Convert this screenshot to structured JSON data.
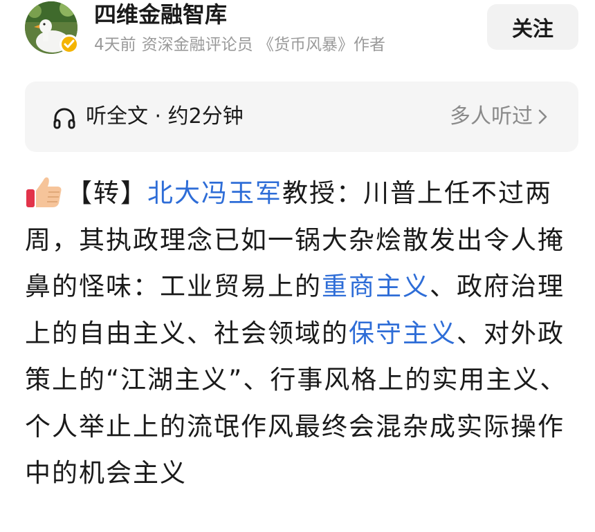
{
  "author": {
    "name": "四维金融智库",
    "time_ago": "4天前",
    "description": "资深金融评论员 《货币风暴》作者",
    "avatar": "duck-avatar",
    "verified_icon": "check-icon"
  },
  "follow": {
    "label": "关注"
  },
  "listen": {
    "icon": "headphone-icon",
    "label": "听全文 · 约2分钟",
    "right_text": "多人听过",
    "right_icon": "chevron-right-icon"
  },
  "article": {
    "emoji": "thumbs-up-icon",
    "segments": [
      {
        "text": "【转】",
        "link": false
      },
      {
        "text": "北大冯玉军",
        "link": true
      },
      {
        "text": "教授：川普上任不过两周，其执政理念已如一锅大杂烩散发出令人掩鼻的怪味：工业贸易上的",
        "link": false
      },
      {
        "text": "重商主义",
        "link": true
      },
      {
        "text": "、政府治理上的自由主义、社会领域的",
        "link": false
      },
      {
        "text": "保守主义",
        "link": true
      },
      {
        "text": "、对外政策上的“江湖主义”、行事风格上的实用主义、个人举止上的流氓作风最终会混杂成实际操作中的机会主义",
        "link": false
      }
    ]
  },
  "colors": {
    "link": "#2e6dd7",
    "verified_badge": "#f4b400",
    "panel_bg": "#f5f5f5",
    "muted_text": "#9a9a9a"
  }
}
